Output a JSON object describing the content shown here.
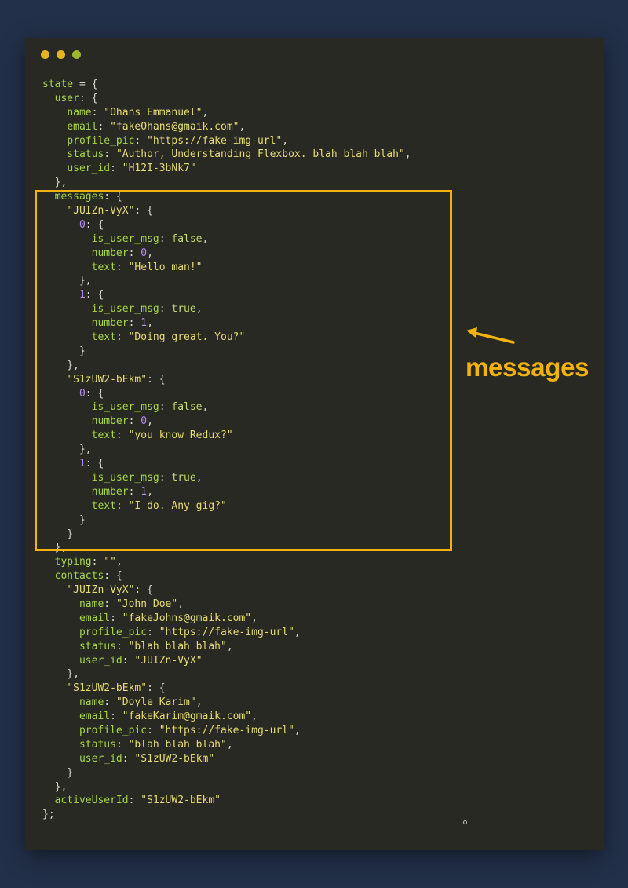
{
  "window": {
    "controls": [
      {
        "name": "close",
        "color": "#e6b422"
      },
      {
        "name": "minimize",
        "color": "#e6b422"
      },
      {
        "name": "maximize",
        "color": "#9fb82a"
      }
    ]
  },
  "annotation": {
    "label": "messages",
    "color": "#f2b20f"
  },
  "code_lines": [
    [
      [
        "k",
        "state"
      ],
      [
        "p",
        " = {"
      ]
    ],
    [
      [
        "p",
        "  "
      ],
      [
        "k",
        "user"
      ],
      [
        "p",
        ": {"
      ]
    ],
    [
      [
        "p",
        "    "
      ],
      [
        "k",
        "name"
      ],
      [
        "p",
        ": "
      ],
      [
        "s",
        "\"Ohans Emmanuel\""
      ],
      [
        "p",
        ","
      ]
    ],
    [
      [
        "p",
        "    "
      ],
      [
        "k",
        "email"
      ],
      [
        "p",
        ": "
      ],
      [
        "s",
        "\"fakeOhans@gmaik.com\""
      ],
      [
        "p",
        ","
      ]
    ],
    [
      [
        "p",
        "    "
      ],
      [
        "k",
        "profile_pic"
      ],
      [
        "p",
        ": "
      ],
      [
        "s",
        "\"https://fake-img-url\""
      ],
      [
        "p",
        ","
      ]
    ],
    [
      [
        "p",
        "    "
      ],
      [
        "k",
        "status"
      ],
      [
        "p",
        ": "
      ],
      [
        "s",
        "\"Author, Understanding Flexbox. blah blah blah\""
      ],
      [
        "p",
        ","
      ]
    ],
    [
      [
        "p",
        "    "
      ],
      [
        "k",
        "user_id"
      ],
      [
        "p",
        ": "
      ],
      [
        "s",
        "\"H12I-3bNk7\""
      ]
    ],
    [
      [
        "p",
        "  },"
      ]
    ],
    [
      [
        "p",
        "  "
      ],
      [
        "k",
        "messages"
      ],
      [
        "p",
        ": {"
      ]
    ],
    [
      [
        "p",
        "    "
      ],
      [
        "s",
        "\"JUIZn-VyX\""
      ],
      [
        "p",
        ": {"
      ]
    ],
    [
      [
        "p",
        "      "
      ],
      [
        "n",
        "0"
      ],
      [
        "p",
        ": {"
      ]
    ],
    [
      [
        "p",
        "        "
      ],
      [
        "k",
        "is_user_msg"
      ],
      [
        "p",
        ": "
      ],
      [
        "b",
        "false"
      ],
      [
        "p",
        ","
      ]
    ],
    [
      [
        "p",
        "        "
      ],
      [
        "k",
        "number"
      ],
      [
        "p",
        ": "
      ],
      [
        "n",
        "0"
      ],
      [
        "p",
        ","
      ]
    ],
    [
      [
        "p",
        "        "
      ],
      [
        "k",
        "text"
      ],
      [
        "p",
        ": "
      ],
      [
        "s",
        "\"Hello man!\""
      ]
    ],
    [
      [
        "p",
        "      },"
      ]
    ],
    [
      [
        "p",
        "      "
      ],
      [
        "n",
        "1"
      ],
      [
        "p",
        ": {"
      ]
    ],
    [
      [
        "p",
        "        "
      ],
      [
        "k",
        "is_user_msg"
      ],
      [
        "p",
        ": "
      ],
      [
        "b",
        "true"
      ],
      [
        "p",
        ","
      ]
    ],
    [
      [
        "p",
        "        "
      ],
      [
        "k",
        "number"
      ],
      [
        "p",
        ": "
      ],
      [
        "n",
        "1"
      ],
      [
        "p",
        ","
      ]
    ],
    [
      [
        "p",
        "        "
      ],
      [
        "k",
        "text"
      ],
      [
        "p",
        ": "
      ],
      [
        "s",
        "\"Doing great. You?\""
      ]
    ],
    [
      [
        "p",
        "      }"
      ]
    ],
    [
      [
        "p",
        "    },"
      ]
    ],
    [
      [
        "p",
        "    "
      ],
      [
        "s",
        "\"S1zUW2-bEkm\""
      ],
      [
        "p",
        ": {"
      ]
    ],
    [
      [
        "p",
        "      "
      ],
      [
        "n",
        "0"
      ],
      [
        "p",
        ": {"
      ]
    ],
    [
      [
        "p",
        "        "
      ],
      [
        "k",
        "is_user_msg"
      ],
      [
        "p",
        ": "
      ],
      [
        "b",
        "false"
      ],
      [
        "p",
        ","
      ]
    ],
    [
      [
        "p",
        "        "
      ],
      [
        "k",
        "number"
      ],
      [
        "p",
        ": "
      ],
      [
        "n",
        "0"
      ],
      [
        "p",
        ","
      ]
    ],
    [
      [
        "p",
        "        "
      ],
      [
        "k",
        "text"
      ],
      [
        "p",
        ": "
      ],
      [
        "s",
        "\"you know Redux?\""
      ]
    ],
    [
      [
        "p",
        "      },"
      ]
    ],
    [
      [
        "p",
        "      "
      ],
      [
        "n",
        "1"
      ],
      [
        "p",
        ": {"
      ]
    ],
    [
      [
        "p",
        "        "
      ],
      [
        "k",
        "is_user_msg"
      ],
      [
        "p",
        ": "
      ],
      [
        "b",
        "true"
      ],
      [
        "p",
        ","
      ]
    ],
    [
      [
        "p",
        "        "
      ],
      [
        "k",
        "number"
      ],
      [
        "p",
        ": "
      ],
      [
        "n",
        "1"
      ],
      [
        "p",
        ","
      ]
    ],
    [
      [
        "p",
        "        "
      ],
      [
        "k",
        "text"
      ],
      [
        "p",
        ": "
      ],
      [
        "s",
        "\"I do. Any gig?\""
      ]
    ],
    [
      [
        "p",
        "      }"
      ]
    ],
    [
      [
        "p",
        "    }"
      ]
    ],
    [
      [
        "p",
        "  },"
      ]
    ],
    [
      [
        "p",
        "  "
      ],
      [
        "k",
        "typing"
      ],
      [
        "p",
        ": "
      ],
      [
        "s",
        "\"\""
      ],
      [
        "p",
        ","
      ]
    ],
    [
      [
        "p",
        "  "
      ],
      [
        "k",
        "contacts"
      ],
      [
        "p",
        ": {"
      ]
    ],
    [
      [
        "p",
        "    "
      ],
      [
        "s",
        "\"JUIZn-VyX\""
      ],
      [
        "p",
        ": {"
      ]
    ],
    [
      [
        "p",
        "      "
      ],
      [
        "k",
        "name"
      ],
      [
        "p",
        ": "
      ],
      [
        "s",
        "\"John Doe\""
      ],
      [
        "p",
        ","
      ]
    ],
    [
      [
        "p",
        "      "
      ],
      [
        "k",
        "email"
      ],
      [
        "p",
        ": "
      ],
      [
        "s",
        "\"fakeJohns@gmaik.com\""
      ],
      [
        "p",
        ","
      ]
    ],
    [
      [
        "p",
        "      "
      ],
      [
        "k",
        "profile_pic"
      ],
      [
        "p",
        ": "
      ],
      [
        "s",
        "\"https://fake-img-url\""
      ],
      [
        "p",
        ","
      ]
    ],
    [
      [
        "p",
        "      "
      ],
      [
        "k",
        "status"
      ],
      [
        "p",
        ": "
      ],
      [
        "s",
        "\"blah blah blah\""
      ],
      [
        "p",
        ","
      ]
    ],
    [
      [
        "p",
        "      "
      ],
      [
        "k",
        "user_id"
      ],
      [
        "p",
        ": "
      ],
      [
        "s",
        "\"JUIZn-VyX\""
      ]
    ],
    [
      [
        "p",
        "    },"
      ]
    ],
    [
      [
        "p",
        "    "
      ],
      [
        "s",
        "\"S1zUW2-bEkm\""
      ],
      [
        "p",
        ": {"
      ]
    ],
    [
      [
        "p",
        "      "
      ],
      [
        "k",
        "name"
      ],
      [
        "p",
        ": "
      ],
      [
        "s",
        "\"Doyle Karim\""
      ],
      [
        "p",
        ","
      ]
    ],
    [
      [
        "p",
        "      "
      ],
      [
        "k",
        "email"
      ],
      [
        "p",
        ": "
      ],
      [
        "s",
        "\"fakeKarim@gmaik.com\""
      ],
      [
        "p",
        ","
      ]
    ],
    [
      [
        "p",
        "      "
      ],
      [
        "k",
        "profile_pic"
      ],
      [
        "p",
        ": "
      ],
      [
        "s",
        "\"https://fake-img-url\""
      ],
      [
        "p",
        ","
      ]
    ],
    [
      [
        "p",
        "      "
      ],
      [
        "k",
        "status"
      ],
      [
        "p",
        ": "
      ],
      [
        "s",
        "\"blah blah blah\""
      ],
      [
        "p",
        ","
      ]
    ],
    [
      [
        "p",
        "      "
      ],
      [
        "k",
        "user_id"
      ],
      [
        "p",
        ": "
      ],
      [
        "s",
        "\"S1zUW2-bEkm\""
      ]
    ],
    [
      [
        "p",
        "    }"
      ]
    ],
    [
      [
        "p",
        "  },"
      ]
    ],
    [
      [
        "p",
        "  "
      ],
      [
        "k",
        "activeUserId"
      ],
      [
        "p",
        ": "
      ],
      [
        "s",
        "\"S1zUW2-bEkm\""
      ]
    ],
    [
      [
        "p",
        "};"
      ]
    ]
  ]
}
